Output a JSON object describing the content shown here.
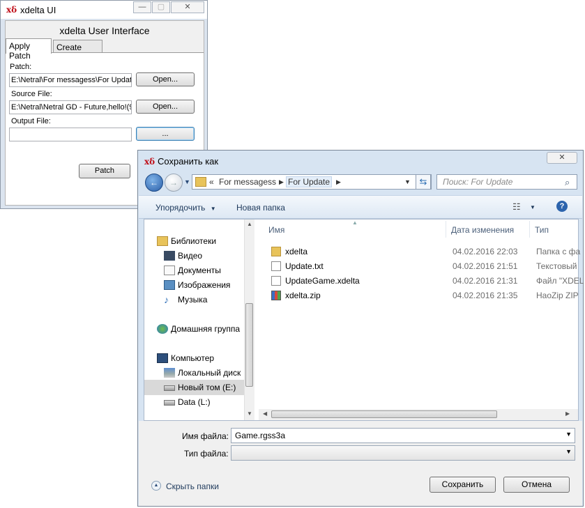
{
  "xdelta_window": {
    "title": "xdelta UI",
    "header": "xdelta User Interface",
    "tabs": [
      "Apply Patch",
      "Create Patch"
    ],
    "patch_label": "Patch:",
    "patch_value": "E:\\Netral\\For messagess\\For Update",
    "source_label": "Source File:",
    "source_value": "E:\\Netral\\Netral GD - Future,hello!(9",
    "output_label": "Output File:",
    "output_value": "",
    "open_button": "Open...",
    "browse_button": "...",
    "patch_button": "Patch",
    "minimize": "—",
    "maximize": "▢",
    "close": "✕"
  },
  "save_dialog": {
    "title": "Сохранить как",
    "close": "✕",
    "breadcrumb_prefix": "«",
    "breadcrumbs": [
      "For messagess",
      "For Update"
    ],
    "search_placeholder": "Поиск: For Update",
    "toolbar": {
      "organize": "Упорядочить",
      "new_folder": "Новая папка"
    },
    "nav": {
      "libraries": "Библиотеки",
      "video": "Видео",
      "documents": "Документы",
      "images": "Изображения",
      "music": "Музыка",
      "homegroup": "Домашняя группа",
      "computer": "Компьютер",
      "local_disk": "Локальный диск",
      "new_volume": "Новый том (E:)",
      "data": "Data (L:)"
    },
    "columns": {
      "name": "Имя",
      "date": "Дата изменения",
      "type": "Тип"
    },
    "files": [
      {
        "name": "xdelta",
        "date": "04.02.2016 22:03",
        "type": "Папка с фа",
        "icon": "folder-icon"
      },
      {
        "name": "Update.txt",
        "date": "04.02.2016 21:51",
        "type": "Текстовый",
        "icon": "text-file-icon"
      },
      {
        "name": "UpdateGame.xdelta",
        "date": "04.02.2016 21:31",
        "type": "Файл \"XDEL",
        "icon": "file-icon"
      },
      {
        "name": "xdelta.zip",
        "date": "04.02.2016 21:35",
        "type": "HaoZip ZIP",
        "icon": "zip-archive-icon"
      }
    ],
    "filename_label": "Имя файла:",
    "filename_value": "Game.rgss3a",
    "filetype_label": "Тип файла:",
    "filetype_value": "",
    "hide_folders": "Скрыть папки",
    "save_button": "Сохранить",
    "cancel_button": "Отмена"
  },
  "colors": {
    "dialog_frame": "#d7e4f2",
    "toolbar_text": "#1e395b",
    "icon_red": "#c0101a",
    "folder": "#e8c35a"
  }
}
